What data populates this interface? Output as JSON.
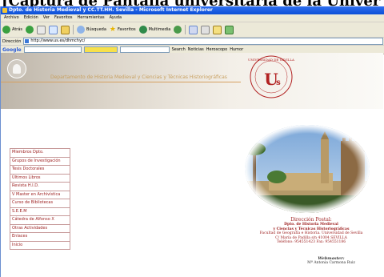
{
  "caption": "[Captura de Pantalla universitaria de la Univer",
  "window": {
    "title": "Dpto. de Historia Medieval y CC.TT.HH. Sevilla - Microsoft Internet Explorer"
  },
  "menu": [
    "Archivo",
    "Edición",
    "Ver",
    "Favoritos",
    "Herramientas",
    "Ayuda"
  ],
  "toolbar": {
    "back_label": "Atrás",
    "search_label": "Búsqueda",
    "favorites_label": "Favoritos",
    "multimedia_label": "Multimedia"
  },
  "addressbar": {
    "label": "Dirección",
    "url": "http://www.us.es/dhmchyc/"
  },
  "googlebar": {
    "logo": "Google",
    "search_label": "Search",
    "btn1": "Noticias",
    "btn2": "Heroscopo",
    "btn3": "Humor"
  },
  "page": {
    "dept_title": "Departamento de Historia Medieval y Ciencias y Técnicas Historiográficas",
    "nav_items": [
      "Miembros Dpto.",
      "Grupos de Investigación",
      "Tesis Doctorales",
      "Últimos Libros",
      "Revista H.I.D.",
      "V Master en Archivística",
      "Curso de Bibliotecas",
      "S.E.E.M",
      "Cátedra de Alfonso X",
      "Otras Actividades",
      "Enlaces",
      "Inicio"
    ],
    "address_head": "Dirección Postal:",
    "address_lines": [
      "Dpto. de Historia Medieval",
      "y Ciencias y Técnicas Historiográficas",
      "Facultad de Geografía e Historia. Universidad de Sevilla",
      "C/ María de Padilla s/n 41004 SEVILLA",
      "Teléfono: 954551423          Fax: 954551186"
    ],
    "webmaster_head": "Webmaster:",
    "webmaster_name": "Mª Antonia Carmona Ruiz"
  },
  "colors": {
    "accent_red": "#9b1b1b",
    "titlebar_blue": "#0b4fd6",
    "gold": "#c8a060"
  }
}
